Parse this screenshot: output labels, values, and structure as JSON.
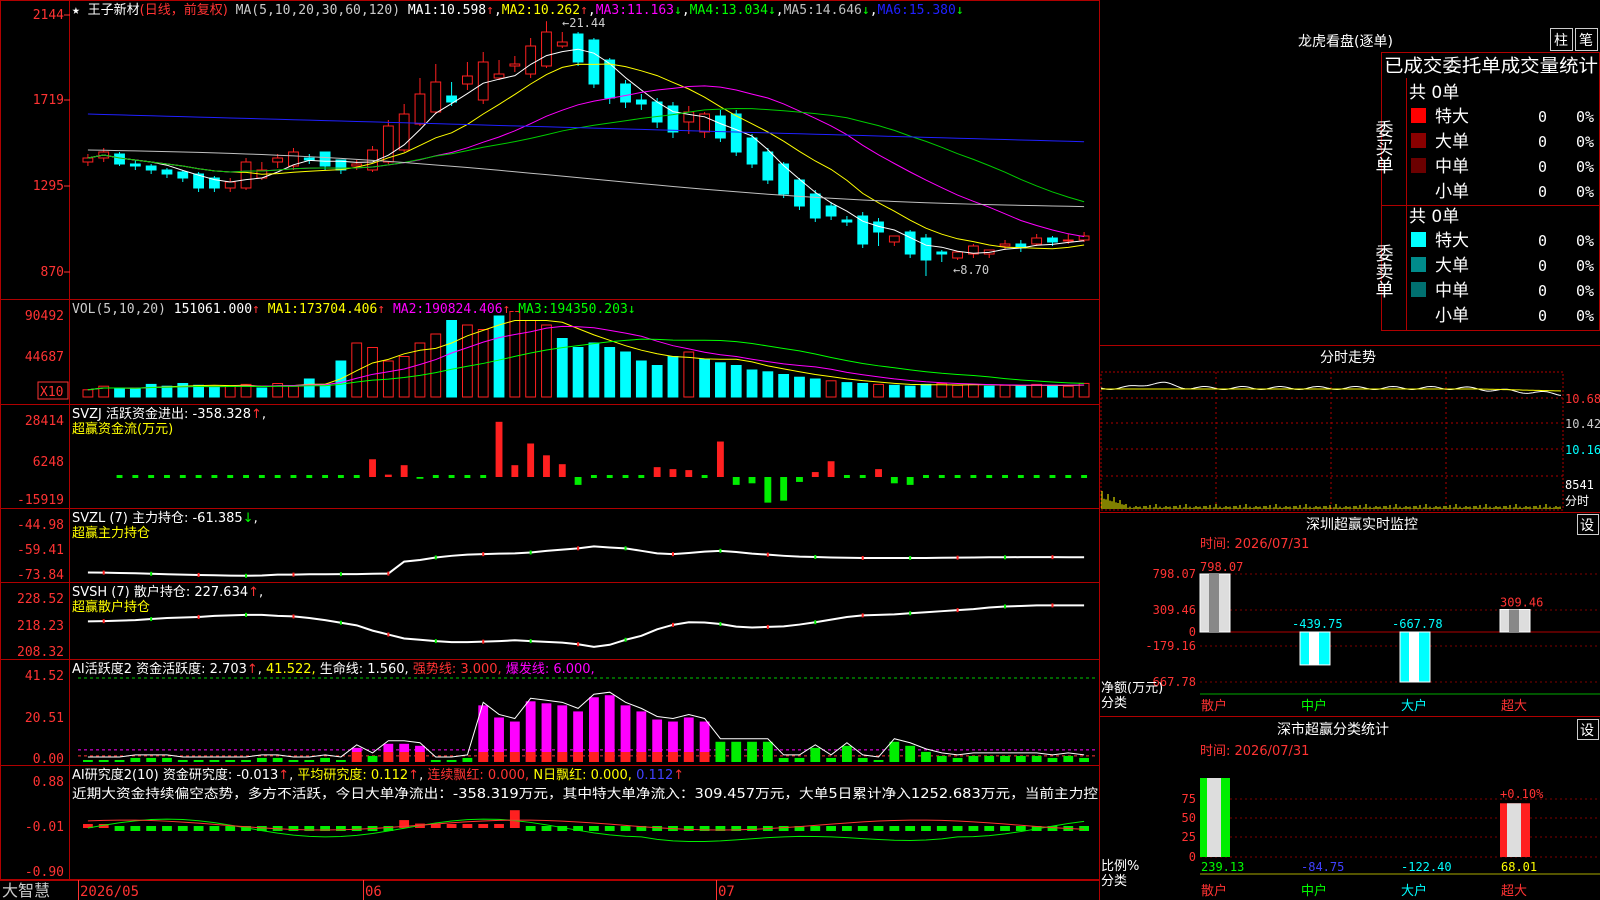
{
  "stock": {
    "name": "王子新材",
    "period": "(日线，前复权)",
    "bottom_brand": "大智慧",
    "dates": [
      "2026/05",
      "06",
      "07"
    ]
  },
  "main_chart": {
    "y_ticks": [
      "2144",
      "1719",
      "1295",
      "870"
    ],
    "ma_header": "MA(5,10,20,30,60,120)",
    "ma": [
      {
        "label": "MA1:",
        "value": "10.598",
        "arrow": "↑",
        "color": "#ffffff"
      },
      {
        "label": "MA2:",
        "value": "10.262",
        "arrow": "↑",
        "color": "#ffff00"
      },
      {
        "label": "MA3:",
        "value": "11.163",
        "arrow": "↓",
        "color": "#ff00ff"
      },
      {
        "label": "MA4:",
        "value": "13.034",
        "arrow": "↓",
        "color": "#00ff00"
      },
      {
        "label": "MA5:",
        "value": "14.646",
        "arrow": "↓",
        "color": "#c0c0c0"
      },
      {
        "label": "MA6:",
        "value": "15.380",
        "arrow": "↓",
        "color": "#2020ff"
      }
    ],
    "high_label": "←21.44",
    "low_label": "←8.70",
    "ylim": [
      8.0,
      22.0
    ]
  },
  "vol_chart": {
    "header": "VOL(5,10,20)",
    "value": "151061.000",
    "ma": [
      {
        "label": "MA1:",
        "value": "173704.406",
        "arrow": "↑",
        "color": "#ffff00"
      },
      {
        "label": "MA2:",
        "value": "190824.406",
        "arrow": "↑",
        "color": "#ff00ff"
      },
      {
        "label": "MA3:",
        "value": "194350.203",
        "arrow": "↓",
        "color": "#00ff00"
      }
    ],
    "y_ticks": [
      "90492",
      "44687"
    ],
    "unit": "X10"
  },
  "svzj": {
    "header": "SVZJ  活跃资金进出: -358.328",
    "sub": "超赢资金流(万元)",
    "y_ticks": [
      "28414",
      "6248",
      "-15919"
    ]
  },
  "svzl": {
    "header": "SVZL (7) 主力持仓: -61.385",
    "sub": "超赢主力持仓",
    "y_ticks": [
      "-44.98",
      "-59.41",
      "-73.84"
    ]
  },
  "svsh": {
    "header": "SVSH (7) 散户持仓: 227.634",
    "sub": "超赢散户持仓",
    "y_ticks": [
      "228.52",
      "218.23",
      "208.32"
    ]
  },
  "ai_active": {
    "header": "AI活跃度2 资金活跃度: 2.703",
    "v1": "41.522,",
    "v2": "生命线: 1.560,",
    "v3": "强势线: 3.000,",
    "v4": "爆发线: 6.000,",
    "y_ticks": [
      "41.52",
      "20.51",
      "0.00"
    ]
  },
  "ai_research": {
    "header": "AI研究度2(10) 资金研究度: -0.013",
    "v1": "平均研究度: 0.112",
    "v2": "连续飘红: 0.000,",
    "v3": "N日飘红: 0.000,",
    "v4": "0.112",
    "commentary": "近期大资金持续偏空态势，多方不活跃，今日大单净流出：-358.319万元，其中特大单净流入：309.457万元，大单5日累计净入1252.683万元，当前主力控",
    "y_ticks": [
      "0.88",
      "-0.01",
      "-0.90"
    ]
  },
  "right_panel": {
    "dragon_title": "龙虎看盘(逐单)",
    "btn_zhu": "柱",
    "btn_bi": "笔",
    "order_stats_title": "已成交委托单成交量统计",
    "buy_label": "委买单",
    "sell_label": "委卖单",
    "buy_total": "共 0单",
    "sell_total": "共 0单",
    "buy_rows": [
      {
        "name": "特大",
        "qty": "0",
        "pct": "0%",
        "color": "#ff0000"
      },
      {
        "name": "大单",
        "qty": "0",
        "pct": "0%",
        "color": "#8b0000"
      },
      {
        "name": "中单",
        "qty": "0",
        "pct": "0%",
        "color": "#6b0000"
      },
      {
        "name": "小单",
        "qty": "0",
        "pct": "0%",
        "color": ""
      }
    ],
    "sell_rows": [
      {
        "name": "特大",
        "qty": "0",
        "pct": "0%",
        "color": "#00ffff"
      },
      {
        "name": "大单",
        "qty": "0",
        "pct": "0%",
        "color": "#008b8b"
      },
      {
        "name": "中单",
        "qty": "0",
        "pct": "0%",
        "color": "#007070"
      },
      {
        "name": "小单",
        "qty": "0",
        "pct": "0%",
        "color": ""
      }
    ],
    "intraday_title": "分时走势",
    "intraday_ticks": [
      "10.68",
      "10.42",
      "10.16",
      "8541",
      "分时"
    ],
    "sz_monitor_title": "深圳超赢实时监控",
    "sz_monitor_set": "设",
    "sz_time": "时间: 2026/07/31",
    "sz_y_ticks": [
      "798.07",
      "309.46",
      "0",
      "-179.16",
      "-667.78"
    ],
    "sz_axis_label1": "净额(万元)",
    "sz_axis_label2": "分类",
    "sz_bars": [
      {
        "cat": "散户",
        "value": 798.07,
        "label": "798.07"
      },
      {
        "cat": "中户",
        "value": -439.75,
        "label": "-439.75"
      },
      {
        "cat": "大户",
        "value": -667.78,
        "label": "-667.78"
      },
      {
        "cat": "超大",
        "value": 309.46,
        "label": "309.46"
      }
    ],
    "sz_class_title": "深市超赢分类统计",
    "sz_class_set": "设",
    "class_time": "时间: 2026/07/31",
    "class_y_ticks": [
      "75",
      "50",
      "25",
      "0"
    ],
    "class_axis_label1": "比例%",
    "class_axis_label2": "分类",
    "class_pct_label": "+0.10%",
    "class_bars": [
      {
        "cat": "散户",
        "pct": 100,
        "label": "239.13"
      },
      {
        "cat": "中户",
        "pct": 0,
        "label": "-84.75"
      },
      {
        "cat": "大户",
        "pct": 0,
        "label": "-122.40"
      },
      {
        "cat": "超大",
        "pct": 68,
        "label": "68.01"
      }
    ]
  },
  "chart_data": [
    {
      "type": "candlestick",
      "title": "王子新材 (日线，前复权)",
      "note": "daily candles, approximate read from chart",
      "ylim": [
        8.0,
        22.0
      ],
      "open": [
        14.4,
        14.6,
        14.8,
        14.3,
        14.2,
        14.0,
        13.9,
        13.8,
        13.6,
        13.1,
        13.1,
        13.6,
        14.4,
        14.2,
        14.6,
        14.9,
        14.5,
        14.2,
        14.0,
        14.4,
        15.0,
        16.3,
        16.9,
        17.7,
        18.3,
        17.5,
        18.6,
        19.2,
        18.8,
        19.2,
        20.2,
        20.8,
        20.5,
        19.5,
        18.3,
        17.5,
        17.4,
        17.2,
        16.4,
        15.9,
        16.7,
        16.8,
        15.6,
        14.9,
        14.3,
        13.5,
        12.8,
        12.2,
        11.5,
        11.7,
        11.4,
        10.4,
        10.9,
        10.6,
        9.9,
        9.6,
        9.8,
        9.8,
        10.2,
        10.3,
        10.3,
        10.6,
        10.5,
        10.5
      ],
      "close": [
        14.6,
        14.9,
        14.3,
        14.2,
        14.0,
        13.8,
        13.6,
        13.1,
        13.1,
        13.4,
        14.4,
        14.0,
        14.6,
        14.9,
        14.5,
        14.2,
        14.0,
        14.3,
        15.0,
        16.2,
        16.8,
        17.8,
        18.4,
        17.4,
        18.7,
        19.4,
        18.8,
        19.3,
        20.2,
        20.9,
        20.4,
        19.4,
        18.3,
        17.6,
        17.4,
        17.3,
        16.4,
        15.9,
        16.9,
        16.8,
        15.6,
        14.9,
        14.3,
        13.5,
        12.8,
        12.2,
        11.6,
        11.7,
        11.4,
        10.3,
        10.9,
        10.7,
        9.8,
        9.5,
        9.8,
        9.9,
        10.2,
        10.0,
        10.3,
        10.1,
        10.6,
        10.4,
        10.5,
        10.7
      ],
      "high": [
        14.8,
        15.1,
        14.9,
        14.5,
        14.3,
        14.1,
        14.0,
        13.9,
        13.7,
        13.6,
        14.6,
        14.4,
        14.8,
        15.1,
        14.8,
        14.5,
        14.3,
        14.5,
        15.2,
        16.5,
        17.3,
        18.6,
        19.3,
        18.4,
        19.4,
        19.9,
        19.5,
        19.7,
        20.6,
        21.44,
        20.9,
        20.9,
        20.6,
        19.6,
        18.5,
        17.8,
        17.6,
        17.4,
        17.2,
        16.9,
        17.0,
        17.0,
        15.8,
        15.1,
        14.4,
        13.6,
        13.0,
        12.4,
        11.7,
        11.9,
        11.6,
        10.6,
        11.0,
        10.8,
        10.0,
        9.9,
        10.3,
        10.0,
        10.5,
        10.5,
        10.8,
        10.7,
        10.8,
        10.9
      ],
      "low": [
        14.2,
        14.4,
        14.2,
        14.0,
        13.8,
        13.6,
        13.4,
        12.9,
        12.9,
        12.9,
        13.0,
        13.5,
        14.1,
        14.0,
        14.3,
        14.0,
        13.8,
        14.0,
        13.9,
        14.3,
        14.9,
        16.2,
        16.8,
        17.2,
        18.0,
        17.3,
        18.5,
        18.9,
        18.6,
        19.1,
        20.1,
        19.2,
        18.1,
        17.3,
        17.1,
        17.0,
        16.1,
        15.6,
        15.8,
        15.6,
        15.4,
        14.7,
        14.1,
        13.3,
        12.6,
        12.0,
        11.4,
        11.5,
        11.2,
        10.1,
        10.2,
        10.2,
        9.6,
        8.7,
        9.4,
        9.5,
        9.6,
        9.6,
        10.0,
        9.9,
        10.2,
        10.2,
        10.3,
        10.4
      ],
      "high_mark": 21.44,
      "low_mark": 8.7
    },
    {
      "type": "bar",
      "title": "VOL(5,10,20)",
      "unit": "X10",
      "ylim": [
        0,
        100000
      ],
      "values": [
        8000,
        12000,
        10000,
        9000,
        14000,
        12000,
        15000,
        13000,
        11000,
        12000,
        14000,
        10000,
        15000,
        12000,
        20000,
        14000,
        40000,
        60000,
        55000,
        40000,
        45000,
        60000,
        70000,
        85000,
        80000,
        75000,
        90000,
        95000,
        85000,
        80000,
        65000,
        55000,
        60000,
        55000,
        50000,
        40000,
        35000,
        45000,
        50000,
        42000,
        38000,
        35000,
        30000,
        28000,
        25000,
        22000,
        20000,
        18000,
        16000,
        15000,
        14000,
        13000,
        12000,
        14000,
        15000,
        13000,
        14000,
        12000,
        13000,
        12000,
        14000,
        13000,
        12000,
        15106
      ],
      "down_days": [
        false,
        false,
        true,
        true,
        true,
        true,
        true,
        true,
        true,
        false,
        false,
        true,
        false,
        false,
        true,
        true,
        true,
        false,
        false,
        false,
        false,
        false,
        false,
        true,
        false,
        false,
        true,
        false,
        false,
        false,
        true,
        true,
        true,
        true,
        true,
        true,
        true,
        true,
        false,
        true,
        true,
        true,
        true,
        true,
        true,
        true,
        true,
        false,
        true,
        true,
        false,
        true,
        true,
        true,
        false,
        false,
        false,
        true,
        false,
        true,
        false,
        true,
        false,
        false
      ]
    },
    {
      "type": "bar",
      "title": "SVZJ 活跃资金进出",
      "unit": "万元",
      "ylim": [
        -15919,
        28414
      ],
      "values": [
        0,
        0,
        -400,
        -400,
        -400,
        -400,
        -400,
        -400,
        -400,
        -400,
        -400,
        -400,
        -400,
        -400,
        -400,
        -400,
        -400,
        -400,
        9000,
        1200,
        6000,
        -900,
        -600,
        -500,
        -400,
        -400,
        28000,
        6000,
        17000,
        11000,
        6500,
        -4000,
        -500,
        -400,
        -500,
        -400,
        5000,
        4000,
        3500,
        -400,
        18000,
        -4000,
        -3200,
        -13000,
        -12000,
        -2500,
        2500,
        8000,
        -300,
        -300,
        4000,
        -3200,
        -4000,
        -300,
        -300,
        -300,
        -300,
        -300,
        -300,
        -300,
        -300,
        -300,
        -300,
        -358
      ]
    },
    {
      "type": "line",
      "title": "SVZL (7) 主力持仓",
      "ylim": [
        -73.84,
        -44.98
      ],
      "values": [
        -70.5,
        -70.6,
        -70.8,
        -71,
        -71.3,
        -71.6,
        -71.8,
        -72,
        -72.2,
        -72.4,
        -72.5,
        -72.3,
        -71.8,
        -71.8,
        -71.6,
        -71.6,
        -71.5,
        -71.5,
        -71.3,
        -71.2,
        -64,
        -63,
        -61.5,
        -60.5,
        -59.8,
        -59.5,
        -59.2,
        -59,
        -58.5,
        -57.5,
        -56.8,
        -56,
        -54.8,
        -55.5,
        -56,
        -57.5,
        -59,
        -59.5,
        -58.8,
        -58,
        -57.5,
        -58.2,
        -59.2,
        -59.8,
        -60.5,
        -61,
        -61.2,
        -61.5,
        -61.7,
        -61.8,
        -61.8,
        -61.8,
        -61.8,
        -61.8,
        -61.7,
        -61.6,
        -61.5,
        -61.4,
        -61.4,
        -61.3,
        -61.3,
        -61.3,
        -61.4,
        -61.385
      ]
    },
    {
      "type": "line",
      "title": "SVSH (7) 散户持仓",
      "ylim": [
        208.32,
        228.52
      ],
      "values": [
        221.5,
        221.6,
        221.8,
        222,
        222.4,
        222.8,
        223,
        223.2,
        223.6,
        223.8,
        224,
        224,
        223.6,
        223.4,
        222.8,
        222,
        221,
        220,
        218,
        216.5,
        215,
        214.5,
        214,
        213.6,
        213.6,
        213.8,
        214,
        214.3,
        214,
        213.7,
        213.4,
        212.8,
        211.8,
        212.6,
        214.5,
        216,
        218.5,
        220.2,
        221.2,
        221.1,
        220.5,
        219.5,
        219.2,
        219.4,
        219.6,
        220.3,
        221.2,
        222.2,
        223.2,
        223.8,
        224,
        224.2,
        224.6,
        225,
        225.4,
        225.8,
        226.2,
        226.8,
        227.2,
        227.4,
        227.6,
        227.6,
        227.6,
        227.634
      ]
    },
    {
      "type": "bar",
      "title": "AI活跃度2 资金活跃度",
      "ylim": [
        0,
        41.52
      ],
      "values": [
        1,
        1,
        1,
        2,
        2,
        2,
        1,
        1,
        1,
        1,
        1,
        2,
        2,
        1,
        1,
        2,
        1,
        7,
        3,
        9,
        9,
        8,
        1,
        1,
        2,
        28,
        22,
        20,
        30,
        29,
        28,
        25,
        32,
        33,
        28,
        25,
        21,
        20,
        22,
        20,
        10,
        10,
        10,
        10,
        2,
        2,
        7,
        2,
        8,
        2,
        1,
        10,
        8,
        5,
        3,
        2,
        3,
        3,
        3,
        3,
        3,
        2,
        3,
        2
      ],
      "magenta_days": [
        false,
        false,
        false,
        false,
        false,
        false,
        false,
        false,
        false,
        false,
        false,
        false,
        false,
        false,
        false,
        false,
        false,
        true,
        false,
        true,
        true,
        true,
        false,
        false,
        false,
        true,
        true,
        true,
        true,
        true,
        true,
        true,
        true,
        true,
        true,
        true,
        true,
        true,
        true,
        true,
        false,
        false,
        false,
        false,
        false,
        false,
        false,
        false,
        false,
        false,
        false,
        false,
        false,
        false,
        false,
        false,
        false,
        false,
        false,
        false,
        false,
        false,
        false,
        false
      ],
      "lines": {
        "生命线": 1.56,
        "强势线": 3.0,
        "爆发线": 6.0
      }
    },
    {
      "type": "bar",
      "title": "AI研究度2(10) 资金研究度",
      "ylim": [
        -0.9,
        0.88
      ],
      "values": [
        0.05,
        0.04,
        -0.01,
        -0.01,
        -0.01,
        -0.01,
        -0.01,
        -0.01,
        -0.01,
        -0.01,
        -0.01,
        -0.01,
        -0.01,
        -0.01,
        -0.01,
        -0.01,
        -0.01,
        -0.01,
        -0.01,
        -0.01,
        0.15,
        0.08,
        0.06,
        0.06,
        0.06,
        0.05,
        0.05,
        0.35,
        -0.01,
        -0.02,
        -0.01,
        -0.01,
        -0.01,
        -0.01,
        -0.01,
        -0.01,
        -0.01,
        -0.01,
        -0.01,
        -0.01,
        -0.01,
        -0.01,
        -0.01,
        -0.01,
        -0.01,
        -0.01,
        -0.01,
        -0.01,
        -0.05,
        -0.01,
        -0.01,
        -0.01,
        -0.01,
        -0.01,
        -0.01,
        -0.01,
        -0.01,
        -0.01,
        -0.01,
        -0.01,
        -0.01,
        -0.01,
        -0.01,
        -0.013
      ]
    },
    {
      "type": "bar",
      "title": "深圳超赢实时监控",
      "categories": [
        "散户",
        "中户",
        "大户",
        "超大"
      ],
      "values": [
        798.07,
        -439.75,
        -667.78,
        309.46
      ],
      "ylabel": "净额(万元)",
      "ylim": [
        -667.78,
        798.07
      ]
    },
    {
      "type": "bar",
      "title": "深市超赢分类统计",
      "categories": [
        "散户",
        "中户",
        "大户",
        "超大"
      ],
      "values": [
        100,
        0,
        0,
        68
      ],
      "labels": [
        "239.13",
        "-84.75",
        "-122.40",
        "68.01"
      ],
      "ylabel": "比例%",
      "ylim": [
        0,
        100
      ]
    }
  ]
}
